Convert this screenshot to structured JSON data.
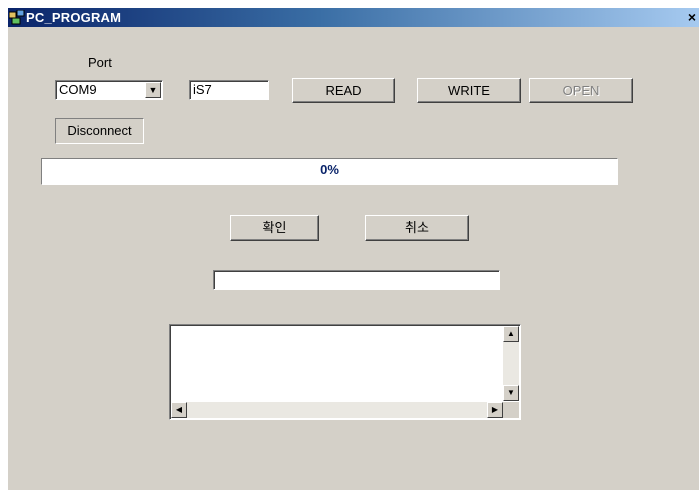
{
  "window": {
    "title": "PC_PROGRAM",
    "close_glyph": "×"
  },
  "port": {
    "label": "Port",
    "selected": "COM9"
  },
  "device_field": {
    "value": "iS7"
  },
  "buttons": {
    "read": "READ",
    "write": "WRITE",
    "open": "OPEN",
    "disconnect": "Disconnect",
    "ok": "확인",
    "cancel": "취소"
  },
  "progress": {
    "text": "0%",
    "value": 0
  },
  "status_field": {
    "value": ""
  },
  "log_box": {
    "text": ""
  },
  "icons": [
    "app-icon",
    "close-icon",
    "chevron-down-icon",
    "scroll-up-icon",
    "scroll-down-icon",
    "scroll-left-icon",
    "scroll-right-icon"
  ]
}
